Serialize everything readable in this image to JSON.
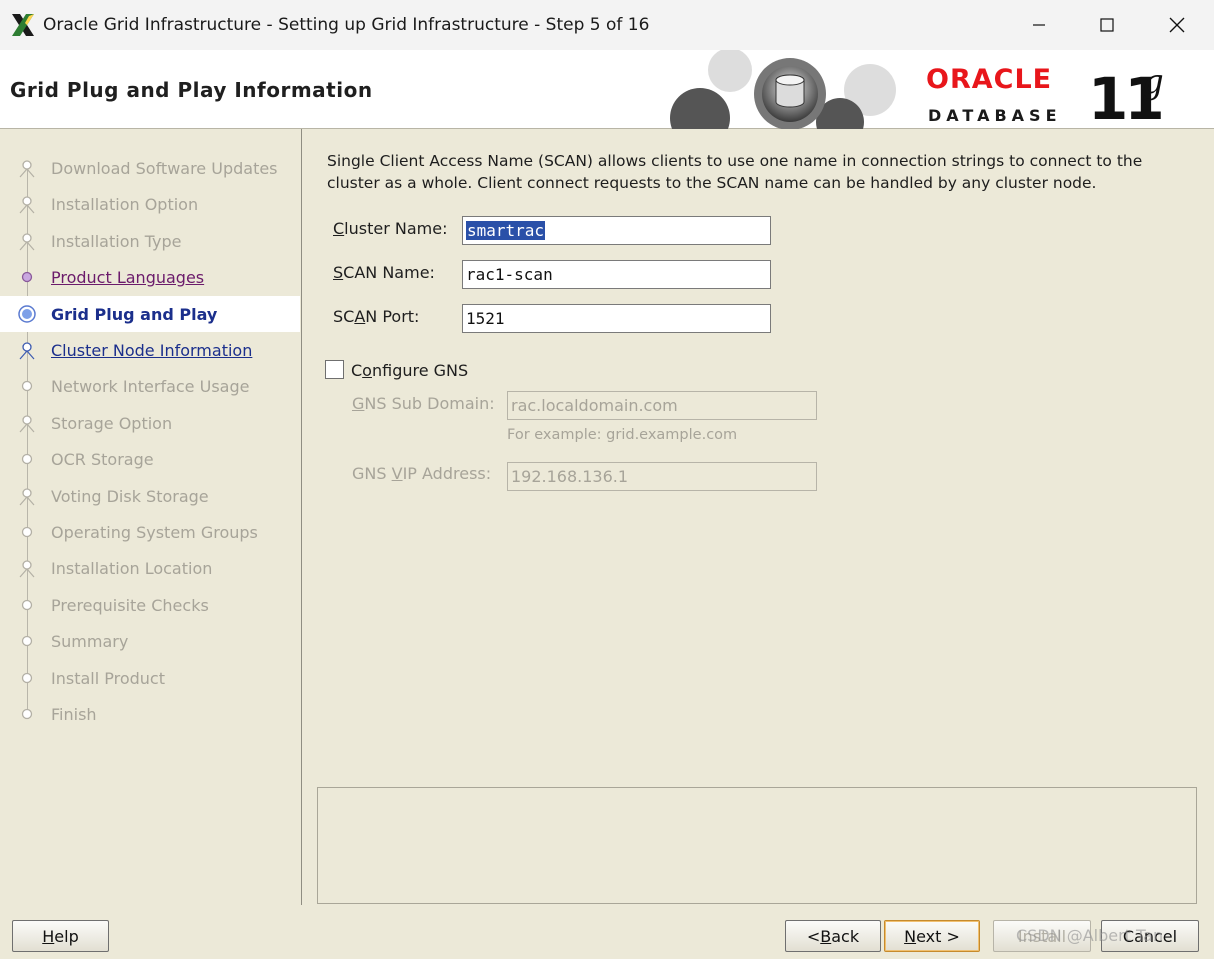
{
  "window": {
    "title": "Oracle Grid Infrastructure - Setting up Grid Infrastructure - Step 5 of 16"
  },
  "header": {
    "heading": "Grid Plug and Play Information",
    "logo_word": "ORACLE",
    "logo_sub": "DATABASE",
    "version_num": "11",
    "version_letter": "g"
  },
  "steps": [
    {
      "label": "Download Software Updates",
      "state": "disabled",
      "icon": "branch-icon"
    },
    {
      "label": "Installation Option",
      "state": "disabled",
      "icon": "branch-icon"
    },
    {
      "label": "Installation Type",
      "state": "disabled",
      "icon": "branch-icon"
    },
    {
      "label": "Product Languages",
      "state": "visited",
      "icon": "dot-icon"
    },
    {
      "label": "Grid Plug and Play",
      "state": "current",
      "icon": "current-dot-icon"
    },
    {
      "label": "Cluster Node Information",
      "state": "link",
      "icon": "branch-icon"
    },
    {
      "label": "Network Interface Usage",
      "state": "disabled",
      "icon": "dot-icon"
    },
    {
      "label": "Storage Option",
      "state": "disabled",
      "icon": "branch-icon"
    },
    {
      "label": "OCR Storage",
      "state": "disabled",
      "icon": "dot-icon"
    },
    {
      "label": "Voting Disk Storage",
      "state": "disabled",
      "icon": "branch-icon"
    },
    {
      "label": "Operating System Groups",
      "state": "disabled",
      "icon": "dot-icon"
    },
    {
      "label": "Installation Location",
      "state": "disabled",
      "icon": "branch-icon"
    },
    {
      "label": "Prerequisite Checks",
      "state": "disabled",
      "icon": "dot-icon"
    },
    {
      "label": "Summary",
      "state": "disabled",
      "icon": "dot-icon"
    },
    {
      "label": "Install Product",
      "state": "disabled",
      "icon": "dot-icon"
    },
    {
      "label": "Finish",
      "state": "disabled",
      "icon": "dot-icon"
    }
  ],
  "main": {
    "intro": "Single Client Access Name (SCAN) allows clients to use one name in connection strings to connect to the cluster as a whole. Client connect requests to the SCAN name can be handled by any cluster node.",
    "cluster_name_label": "Cluster Name:",
    "cluster_name_value": "smartrac",
    "scan_name_label": "SCAN Name:",
    "scan_name_value": "rac1-scan",
    "scan_port_label": "SCAN Port:",
    "scan_port_value": "1521",
    "configure_gns_label": "Configure GNS",
    "configure_gns_checked": false,
    "gns_sub_domain_label": "GNS Sub Domain:",
    "gns_sub_domain_value": "rac.localdomain.com",
    "gns_hint": "For example: grid.example.com",
    "gns_vip_label": "GNS VIP Address:",
    "gns_vip_value": "192.168.136.1"
  },
  "footer": {
    "help": "Help",
    "back": "< Back",
    "next": "Next >",
    "install": "Install",
    "cancel": "Cancel",
    "watermark": "CSDN @Albert Tan"
  },
  "colors": {
    "panel_bg": "#ece9d8",
    "link": "#1b2f8c",
    "visited": "#6b1b6b",
    "disabled": "#a7a499",
    "oracle_red": "#e8161b",
    "selection": "#2a50a8"
  }
}
